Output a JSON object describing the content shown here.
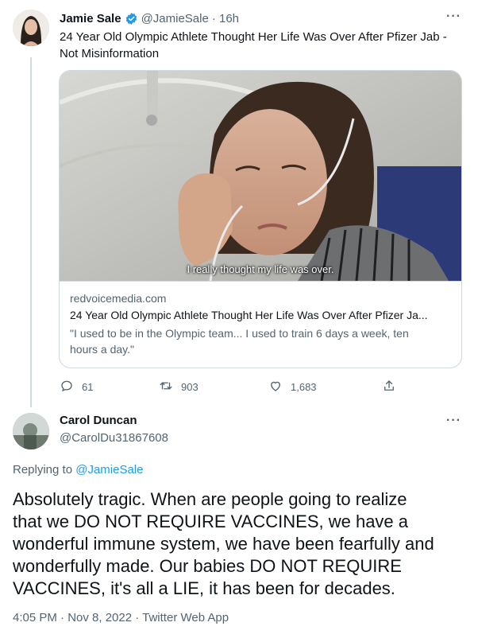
{
  "tweet1": {
    "author_name": "Jamie Sale",
    "handle": "@JamieSale",
    "time": "· 16h",
    "text_line1": "24 Year Old Olympic Athlete Thought Her Life Was Over After Pfizer Jab -",
    "text_line2": "Not Misinformation",
    "card": {
      "caption": "I really thought my life was over.",
      "domain": "redvoicemedia.com",
      "title": "24 Year Old Olympic Athlete Thought Her Life Was Over After Pfizer Ja...",
      "desc_line1": "\"I used to be in the Olympic team... I used to train 6 days a week, ten",
      "desc_line2": "hours a day.\""
    },
    "actions": {
      "replies": "61",
      "retweets": "903",
      "likes": "1,683"
    }
  },
  "tweet2": {
    "author_name": "Carol Duncan",
    "handle": "@CarolDu31867608",
    "replying_prefix": "Replying to",
    "replying_handle": "@JamieSale",
    "text_lines": [
      "Absolutely tragic.  When are people going to realize",
      "that we DO NOT REQUIRE VACCINES, we have a",
      "wonderful immune system, we have been fearfully and",
      "wonderfully made.  Our babies DO NOT REQUIRE",
      "VACCINES, it's all a LIE, it has been for decades."
    ],
    "timestamp": "4:05 PM · Nov 8, 2022 · Twitter Web App"
  },
  "more_label": "···",
  "colors": {
    "accent": "#1d9bf0",
    "muted": "#536471",
    "border": "#cfd9de",
    "text": "#0f1419"
  },
  "icons": [
    "verified-badge-icon",
    "reply-icon",
    "retweet-icon",
    "like-icon",
    "share-icon",
    "more-icon"
  ]
}
